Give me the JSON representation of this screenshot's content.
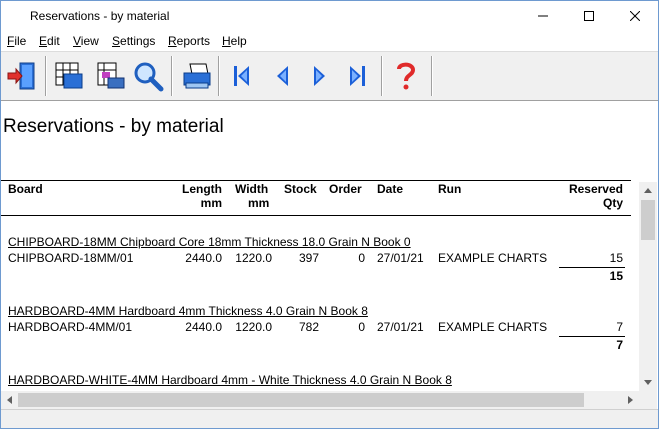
{
  "window": {
    "title": "Reservations - by material"
  },
  "menu": [
    {
      "label": "File",
      "ul": "F",
      "rest": "ile"
    },
    {
      "label": "Edit",
      "ul": "E",
      "rest": "dit"
    },
    {
      "label": "View",
      "ul": "V",
      "rest": "iew"
    },
    {
      "label": "Settings",
      "ul": "S",
      "rest": "ettings"
    },
    {
      "label": "Reports",
      "ul": "R",
      "rest": "eports"
    },
    {
      "label": "Help",
      "ul": "H",
      "rest": "elp"
    }
  ],
  "toolbar": {
    "buttons": [
      "exit-icon",
      "layout-grid-icon",
      "print-preview-icon",
      "zoom-icon",
      "printer-icon",
      "first-page-icon",
      "previous-page-icon",
      "next-page-icon",
      "last-page-icon",
      "help-icon"
    ]
  },
  "report": {
    "title": "Reservations - by material",
    "headers": {
      "board": "Board",
      "length": "Length",
      "length_unit": "mm",
      "width": "Width",
      "width_unit": "mm",
      "stock": "Stock",
      "order": "Order",
      "date": "Date",
      "run": "Run",
      "reserved": "Reserved",
      "reserved_unit": "Qty"
    },
    "groups": [
      {
        "title": "CHIPBOARD-18MM Chipboard Core 18mm Thickness  18.0 Grain N Book 0",
        "row": {
          "board": "CHIPBOARD-18MM/01",
          "length": "2440.0",
          "width": "1220.0",
          "stock": "397",
          "order": "0",
          "date": "27/01/21",
          "run": "EXAMPLE CHARTS",
          "qty": "15"
        },
        "total": "15"
      },
      {
        "title": "HARDBOARD-4MM Hardboard 4mm Thickness   4.0 Grain N Book 8",
        "row": {
          "board": "HARDBOARD-4MM/01",
          "length": "2440.0",
          "width": "1220.0",
          "stock": "782",
          "order": "0",
          "date": "27/01/21",
          "run": "EXAMPLE CHARTS",
          "qty": "7"
        },
        "total": "7"
      },
      {
        "title": "HARDBOARD-WHITE-4MM Hardboard 4mm - White Thickness   4.0 Grain N Book 8"
      }
    ]
  }
}
